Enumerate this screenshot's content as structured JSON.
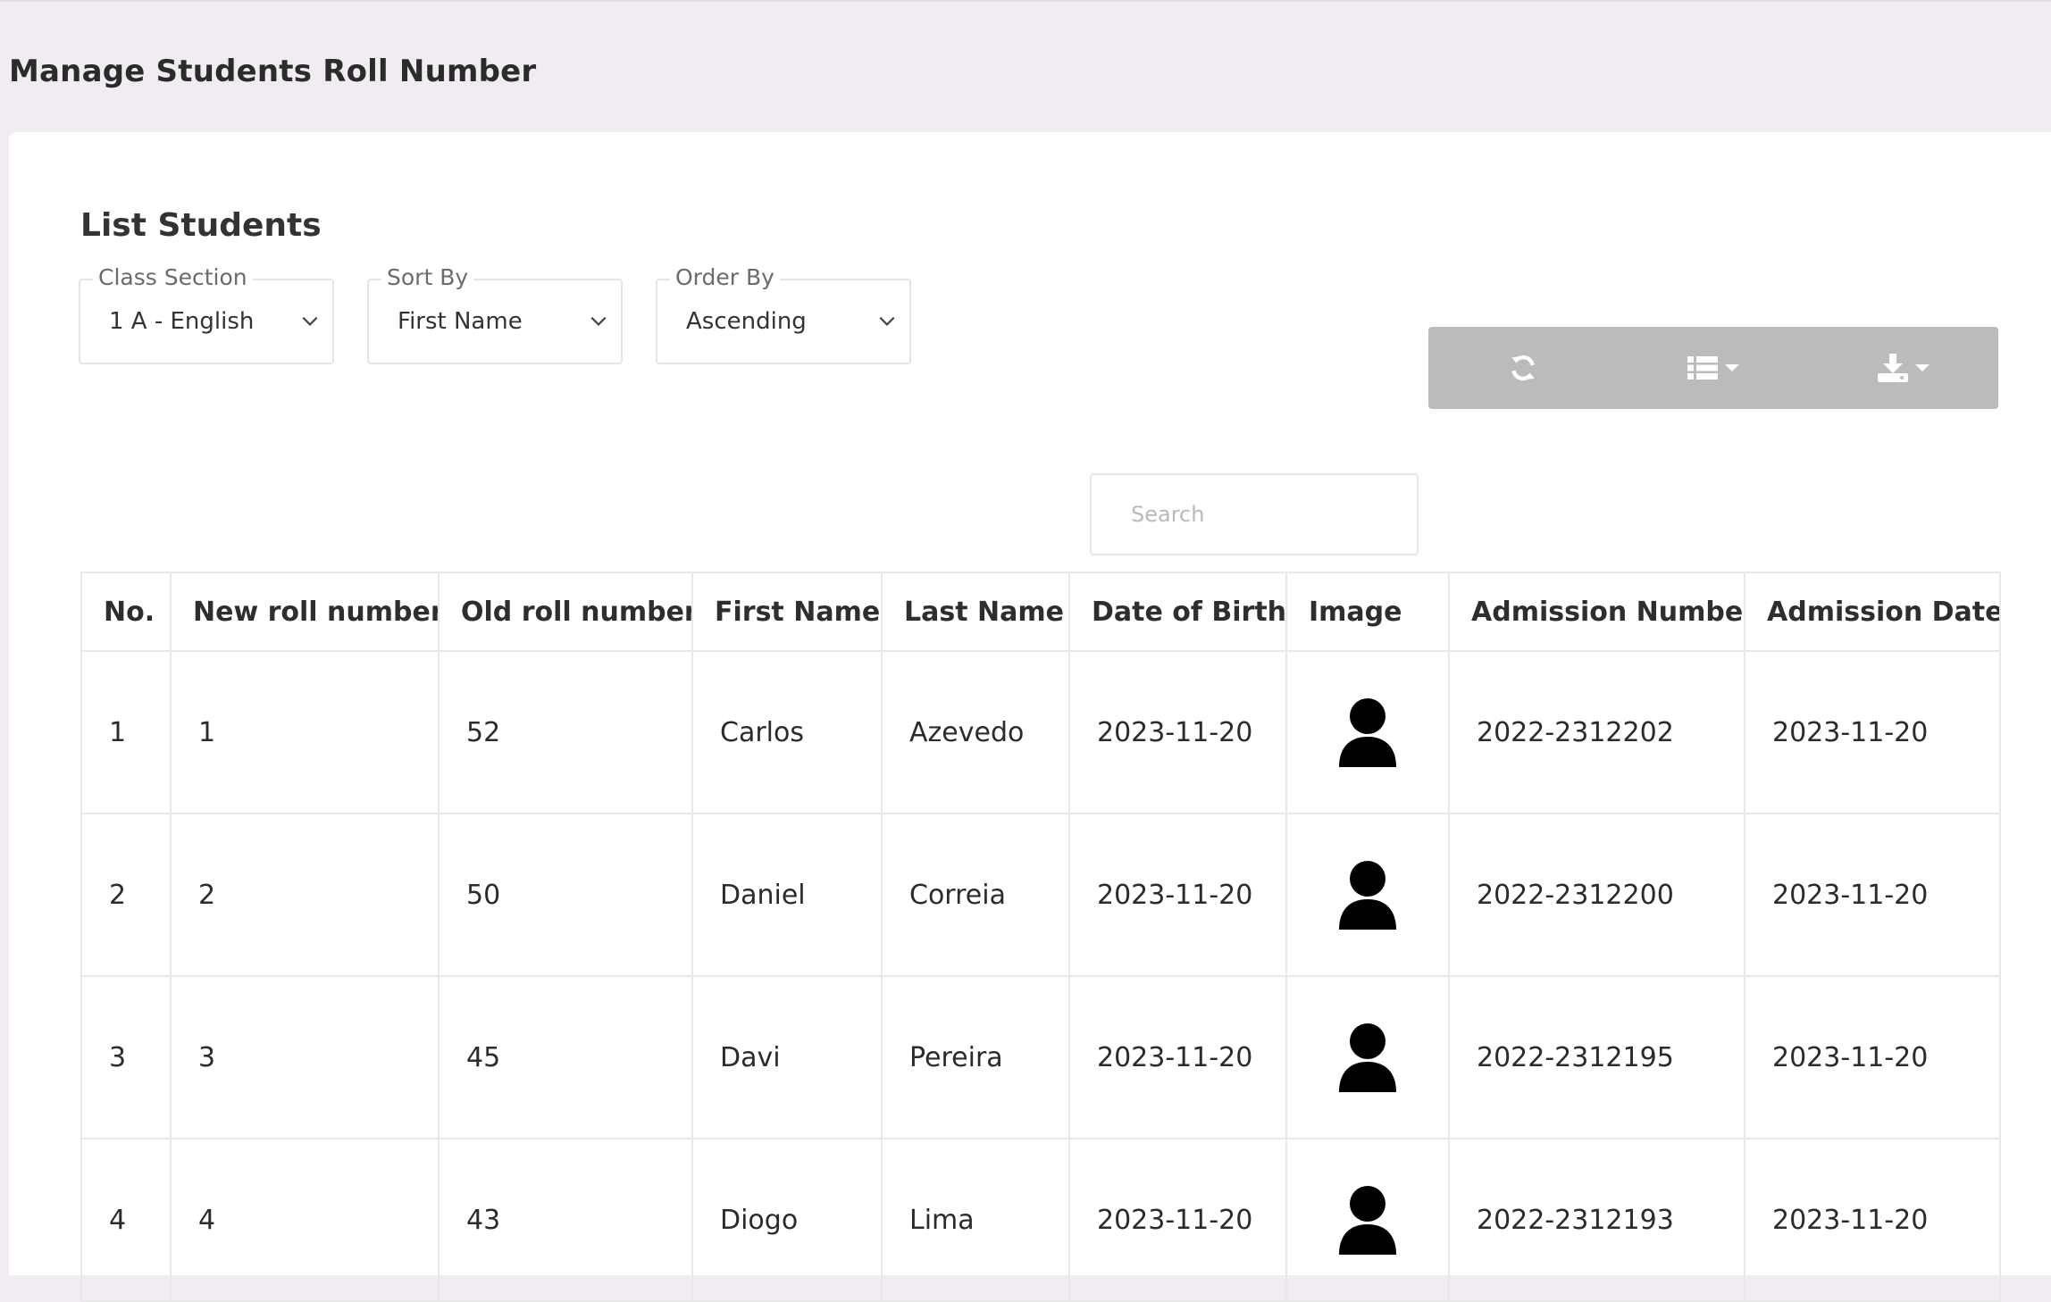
{
  "page": {
    "title": "Manage Students Roll Number"
  },
  "card": {
    "title": "List Students"
  },
  "filters": {
    "class_section": {
      "label": "Class Section",
      "value": "1 A - English"
    },
    "sort_by": {
      "label": "Sort By",
      "value": "First Name"
    },
    "order_by": {
      "label": "Order By",
      "value": "Ascending"
    }
  },
  "toolbar": {
    "buttons": [
      {
        "icon": "refresh-icon"
      },
      {
        "icon": "columns-list-icon",
        "dropdown": true
      },
      {
        "icon": "download-icon",
        "dropdown": true
      }
    ],
    "color": "#bdbabb"
  },
  "search": {
    "placeholder": "Search",
    "value": ""
  },
  "table": {
    "columns": [
      "No.",
      "New roll number",
      "Old roll number",
      "First Name",
      "Last Name",
      "Date of Birth",
      "Image",
      "Admission Number",
      "Admission Date"
    ],
    "rows": [
      {
        "no": "1",
        "new_roll": "1",
        "old_roll": "52",
        "first_name": "Carlos",
        "last_name": "Azevedo",
        "dob": "2023-11-20",
        "image": "user-avatar-icon",
        "admission_number": "2022-2312202",
        "admission_date": "2023-11-20"
      },
      {
        "no": "2",
        "new_roll": "2",
        "old_roll": "50",
        "first_name": "Daniel",
        "last_name": "Correia",
        "dob": "2023-11-20",
        "image": "user-avatar-icon",
        "admission_number": "2022-2312200",
        "admission_date": "2023-11-20"
      },
      {
        "no": "3",
        "new_roll": "3",
        "old_roll": "45",
        "first_name": "Davi",
        "last_name": "Pereira",
        "dob": "2023-11-20",
        "image": "user-avatar-icon",
        "admission_number": "2022-2312195",
        "admission_date": "2023-11-20"
      },
      {
        "no": "4",
        "new_roll": "4",
        "old_roll": "43",
        "first_name": "Diogo",
        "last_name": "Lima",
        "dob": "2023-11-20",
        "image": "user-avatar-icon",
        "admission_number": "2022-2312193",
        "admission_date": "2023-11-20"
      }
    ]
  }
}
